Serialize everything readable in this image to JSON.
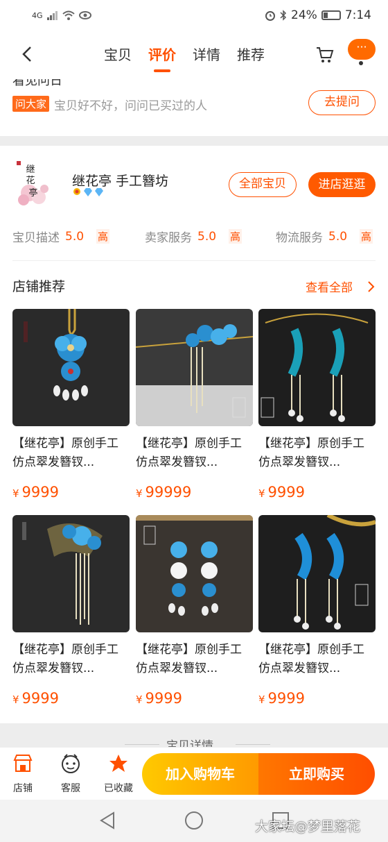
{
  "status_bar": {
    "network": "4G",
    "battery": "24%",
    "time": "7:14"
  },
  "nav": {
    "tabs": [
      {
        "label": "宝贝"
      },
      {
        "label": "评价"
      },
      {
        "label": "详情"
      },
      {
        "label": "推荐"
      }
    ],
    "active_tab": "评价",
    "more_label": "···"
  },
  "ask": {
    "cut_text": "看见问日",
    "tag": "问大家",
    "text": "宝贝好不好，问问已买过的人",
    "button": "去提问"
  },
  "shop": {
    "logo_text": "继花亭",
    "name": "继花亭 手工簪坊",
    "btn_all": "全部宝贝",
    "btn_enter": "进店逛逛",
    "ratings": [
      {
        "label": "宝贝描述",
        "value": "5.0",
        "level": "高"
      },
      {
        "label": "卖家服务",
        "value": "5.0",
        "level": "高"
      },
      {
        "label": "物流服务",
        "value": "5.0",
        "level": "高"
      }
    ]
  },
  "recommend": {
    "title": "店铺推荐",
    "more": "查看全部",
    "products": [
      {
        "title": "【继花亭】原创手工仿点翠发簪钗...",
        "currency": "¥",
        "price": "9999"
      },
      {
        "title": "【继花亭】原创手工仿点翠发簪钗...",
        "currency": "¥",
        "price": "99999"
      },
      {
        "title": "【继花亭】原创手工仿点翠发簪钗...",
        "currency": "¥",
        "price": "9999"
      },
      {
        "title": "【继花亭】原创手工仿点翠发簪钗...",
        "currency": "¥",
        "price": "9999"
      },
      {
        "title": "【继花亭】原创手工仿点翠发簪钗...",
        "currency": "¥",
        "price": "9999"
      },
      {
        "title": "【继花亭】原创手工仿点翠发簪钗...",
        "currency": "¥",
        "price": "9999"
      }
    ]
  },
  "detail_strip": {
    "text": "宝贝详情"
  },
  "actions": {
    "shop": "店铺",
    "service": "客服",
    "favorited": "已收藏",
    "add_cart": "加入购物车",
    "buy_now": "立即购买"
  },
  "watermark": "大家坛@梦里落花",
  "colors": {
    "accent": "#ff5000",
    "cart_gradient": "#ffb400",
    "buy_gradient": "#ff5a00"
  }
}
